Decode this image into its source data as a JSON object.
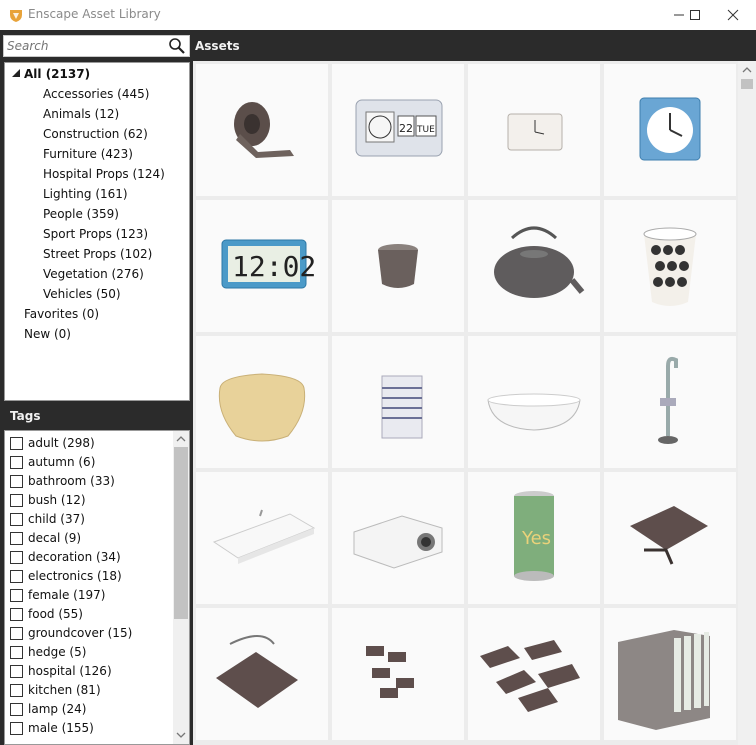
{
  "window": {
    "title": "Enscape Asset Library",
    "minimize_icon": "minimize-icon",
    "maximize_icon": "maximize-icon",
    "close_icon": "close-icon"
  },
  "search": {
    "placeholder": "Search",
    "value": ""
  },
  "tree": {
    "root": {
      "label": "All (2137)",
      "expanded": true
    },
    "children": [
      "Accessories (445)",
      "Animals (12)",
      "Construction (62)",
      "Furniture (423)",
      "Hospital Props (124)",
      "Lighting (161)",
      "People (359)",
      "Sport Props (123)",
      "Street Props (102)",
      "Vegetation (276)",
      "Vehicles (50)"
    ],
    "others": [
      "Favorites (0)",
      "New (0)"
    ]
  },
  "tags": {
    "header": "Tags",
    "items": [
      "adult (298)",
      "autumn (6)",
      "bathroom (33)",
      "bush (12)",
      "child (37)",
      "decal (9)",
      "decoration (34)",
      "electronics (18)",
      "female (197)",
      "food (55)",
      "groundcover (15)",
      "hedge (5)",
      "hospital (126)",
      "kitchen (81)",
      "lamp (24)",
      "male (155)"
    ]
  },
  "assets": {
    "header": "Assets",
    "items": [
      "tape-dispenser",
      "flip-clock",
      "white-alarm-clock",
      "blue-alarm-clock",
      "digital-clock",
      "metal-cup",
      "cast-iron-teapot",
      "patterned-bucket",
      "woven-basket",
      "folded-towel",
      "bathtub",
      "floor-faucet",
      "wall-sink",
      "projector",
      "soda-can",
      "binder-clip",
      "binder-clip-large",
      "binder-clip-set",
      "binder-clip-pile",
      "file-binders"
    ]
  },
  "colors": {
    "dark_bg": "#2b2b2b",
    "panel_bg": "#ffffff",
    "tile_bg": "#fafafa",
    "grid_bg": "#ececec",
    "header_text": "#f2f2f2",
    "accent_orange": "#e8a33a"
  }
}
